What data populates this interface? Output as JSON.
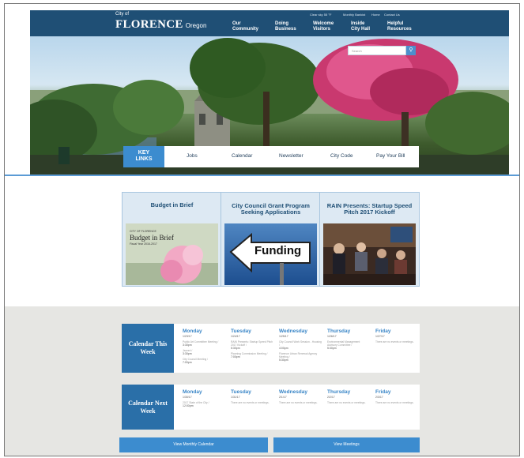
{
  "header": {
    "city_prefix": "City of",
    "city_name": "FLORENCE",
    "state": "Oregon",
    "utility": {
      "weather": "Clear sky 55 °F",
      "monthly": "Monthly Bankist",
      "home": "Home",
      "contact": "Contact Us"
    },
    "nav": [
      {
        "line1": "Our",
        "line2": "Community"
      },
      {
        "line1": "Doing",
        "line2": "Business"
      },
      {
        "line1": "Welcome",
        "line2": "Visitors"
      },
      {
        "line1": "Inside",
        "line2": "City Hall"
      },
      {
        "line1": "Helpful",
        "line2": "Resources"
      }
    ]
  },
  "search": {
    "placeholder": "Search",
    "button_icon": "search-icon"
  },
  "key_links": {
    "title_line1": "KEY",
    "title_line2": "LINKS",
    "links": [
      "Jobs",
      "Calendar",
      "Newsletter",
      "City Code",
      "Pay Your Bill"
    ]
  },
  "cards": [
    {
      "title": "Budget in Brief",
      "img_line1": "CITY OF FLORENCE",
      "img_line2": "Budget in Brief",
      "img_line3": "Fiscal Year 2016-2017"
    },
    {
      "title": "City Council Grant Program Seeking Applications",
      "img_text": "Funding"
    },
    {
      "title": "RAIN Presents: Startup Speed Pitch 2017 Kickoff"
    }
  ],
  "calendar_this_week": {
    "label_line1": "Calendar This",
    "label_line2": "Week",
    "days": [
      {
        "name": "Monday",
        "date": "1/23/17",
        "events": [
          "Public Art Committee Meeting /",
          "3:30pm",
          "Jazzerl /",
          "3:30pm",
          "City Council Meeting /",
          "7:00pm"
        ]
      },
      {
        "name": "Tuesday",
        "date": "1/24/17",
        "events": [
          "RAIN Presents: Startup Speed Pitch 2017 Kickoff /",
          "5:30pm",
          "Planning Commission Meeting /",
          "7:00pm"
        ]
      },
      {
        "name": "Wednesday",
        "date": "1/25/17",
        "events": [
          "City Council Work Session - Housing /",
          "4:00pm",
          "Florence Urban Renewal Agency Meeting /",
          "5:30pm"
        ]
      },
      {
        "name": "Thursday",
        "date": "1/26/17",
        "events": [
          "Environmental Management Advisory Committee /",
          "5:30pm"
        ]
      },
      {
        "name": "Friday",
        "date": "1/27/17",
        "events": [
          "There are no events or meetings."
        ]
      }
    ]
  },
  "calendar_next_week": {
    "label_line1": "Calendar Next",
    "label_line2": "Week",
    "days": [
      {
        "name": "Monday",
        "date": "1/30/17",
        "events": [
          "2017 State of the City /",
          "12:00pm"
        ]
      },
      {
        "name": "Tuesday",
        "date": "1/31/17",
        "events": [
          "There are no events or meetings."
        ]
      },
      {
        "name": "Wednesday",
        "date": "2/1/17",
        "events": [
          "There are no events or meetings."
        ]
      },
      {
        "name": "Thursday",
        "date": "2/2/17",
        "events": [
          "There are no events or meetings."
        ]
      },
      {
        "name": "Friday",
        "date": "2/3/17",
        "events": [
          "There are no events or meetings."
        ]
      }
    ]
  },
  "buttons": {
    "monthly": "View Monthly Calendar",
    "meetings": "View Meetings"
  },
  "colors": {
    "header": "#1f4f75",
    "accent": "#3c8ccf",
    "day_name": "#3a86c7",
    "calendar_label": "#2a6fa8"
  }
}
